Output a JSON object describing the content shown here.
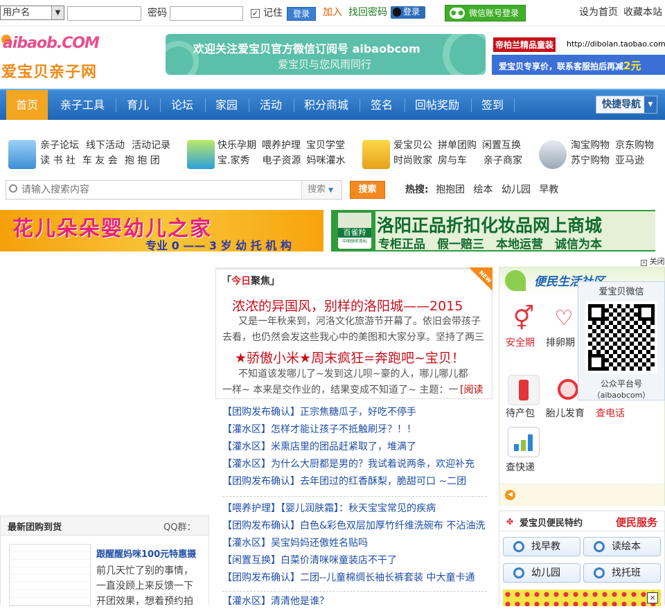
{
  "topbar": {
    "user_select": "用户名",
    "password_label": "密码",
    "remember_label": "记住",
    "login_btn": "登录",
    "join": "加入",
    "find_password": "找回密码",
    "qq_login": "登录",
    "wechat_login": "微信账号登录",
    "set_home": "设为首页",
    "favorite": "收藏本站"
  },
  "header": {
    "logo_text": "aibaob.COM",
    "logo_cn": "爱宝贝亲子网",
    "banner_line1": "欢迎关注爱宝贝官方微信订阅号 aibaobcom",
    "banner_line2": "爱宝贝与您风雨同行",
    "promo_title": "帝柏兰精品童装",
    "promo_url": "http://dibolan.taobao.com",
    "promo_line2a": "爱宝贝专享价，联系客服拍后再减",
    "promo_line2b": "2元"
  },
  "nav": {
    "items": [
      "首页",
      "亲子工具",
      "育儿",
      "论坛",
      "家园",
      "活动",
      "积分商城",
      "签名",
      "回帖奖励",
      "签到"
    ],
    "quick": "快捷导航"
  },
  "links": {
    "g1": [
      [
        "亲子论坛",
        "线下活动",
        "活动记录"
      ],
      [
        "读 书 社",
        "车 友 会",
        "抱 抱 团"
      ]
    ],
    "g2": [
      [
        "快乐孕期",
        "喂养护理",
        "宝贝学堂"
      ],
      [
        "宝.家秀",
        "电子资源",
        "妈咪灌水"
      ]
    ],
    "g3": [
      [
        "爱宝贝公",
        "拼单团购",
        "闲置互换"
      ],
      [
        "时尚败家",
        "房与车",
        "亲子商家"
      ]
    ],
    "g4": [
      [
        "淘宝购物",
        "京东购物"
      ],
      [
        "苏宁购物",
        "亚马逊"
      ]
    ]
  },
  "search": {
    "placeholder": "请输入搜索内容",
    "type": "搜索",
    "button": "搜索",
    "hot_label": "热搜:",
    "hot": [
      "抱抱团",
      "绘本",
      "幼儿园",
      "早教"
    ]
  },
  "ads": {
    "left_title": "花儿朵朵婴幼儿之家",
    "left_sub": "专业 0 —— 3 岁 幼 托 机 构",
    "right_logo": "百雀羚",
    "right_logo_sub": "中国驰名商标",
    "right_title": "洛阳正品折扣化妆品网上商城",
    "right_sub": "专柜正品　假一赔三　本地运营　诚信为本",
    "close": "关闭"
  },
  "focus": {
    "tag_a": "今日",
    "tag_b": "聚焦",
    "new_badge": "NEW",
    "h1": "浓浓的异国风，别样的洛阳城——2015",
    "p1a": "又是一年秋来到，河洛文化旅游节开幕了。依旧会带孩子",
    "p1b": "去看，也仍然会发这些我心中的美图和大家分享。坚持了两三",
    "h2": "★骄傲小米★周末疯狂=奔跑吧~宝贝！",
    "p2a": "不知道该发哪儿了~发到这儿呗~豪的人，哪儿哪儿都",
    "p2b": "一样~ 本来是交作业的，结果变成不知道了~ 主题：一",
    "read": "[阅读"
  },
  "news": [
    {
      "cat": "【团购发布确认】",
      "title": "正宗焦糖瓜子，好吃不停手"
    },
    {
      "cat": "【灌水区】",
      "title": "怎样才能让孩子不抵触刷牙？！！"
    },
    {
      "cat": "【灌水区】",
      "title": "米熏店里的团品赶紧取了，堆满了"
    },
    {
      "cat": "【灌水区】",
      "title": "为什么大厨都是男的？我试着说两条，欢迎补充"
    },
    {
      "cat": "【团购发布确认】",
      "title": "去年团过的红香酥梨，脆甜可口 ~二团"
    }
  ],
  "news2": [
    {
      "cat": "【喂养护理】",
      "title": "【婴儿润肤霜】：秋天宝宝常见的疾病"
    },
    {
      "cat": "【团购发布确认】",
      "title": "白色&彩色双层加厚竹纤维洗碗布 不沾油洗"
    },
    {
      "cat": "【灌水区】",
      "title": "吴宝妈妈还傲姓名贴吗"
    },
    {
      "cat": "【闲置互换】",
      "title": "白菜价清咪咪童装店不干了"
    },
    {
      "cat": "【团购发布确认】",
      "title": "二团--儿童棉绸长袖长裤套装 中大童卡通"
    },
    {
      "cat": "【灌水区】",
      "title": "清清他是谁？"
    }
  ],
  "group": {
    "title": "最新团购到货",
    "qq": "QQ群：",
    "item_title": "跟醒醒妈咪100元特惠摄",
    "item_desc1": "前几天忙了别的事情，",
    "item_desc2": "一直没顾上来反馈一下",
    "item_desc3": "开团效果，想着预约拍"
  },
  "service": {
    "title": "便民生活社区",
    "items": [
      "安全期",
      "排卵期",
      "待产包",
      "胎儿发育",
      "查电话",
      "查快递"
    ],
    "qr_title": "爱宝贝微信",
    "qr_name": "公众平台号",
    "qr_id": "（aibaobcom）",
    "special_title": "爱宝贝便民特约",
    "special_right": "便民服务",
    "buttons": [
      "找早教",
      "读绘本",
      "幼儿园",
      "找托班"
    ]
  }
}
